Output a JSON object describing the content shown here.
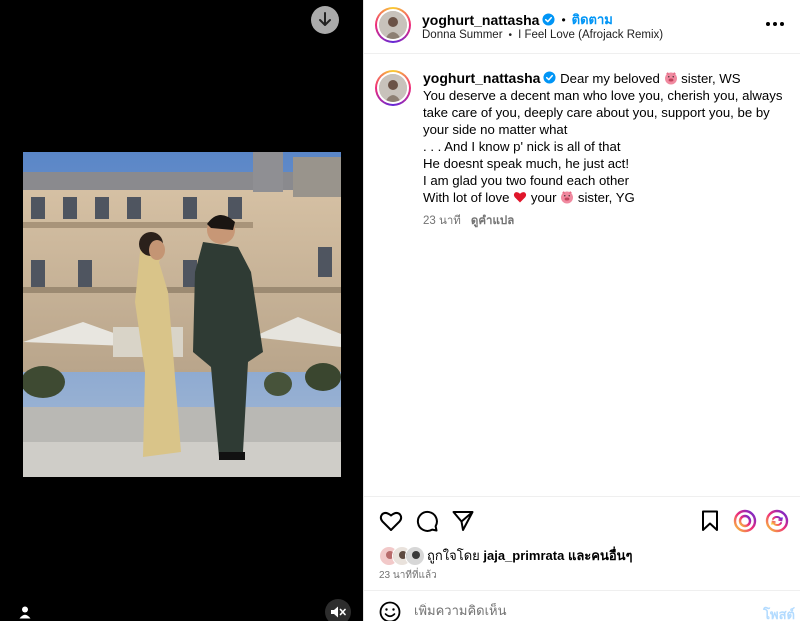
{
  "post": {
    "username": "yoghurt_nattasha",
    "follow_label": "ติดตาม",
    "dot": "•",
    "music": {
      "artist": "Donna Summer",
      "track": "I Feel Love (Afrojack Remix)"
    }
  },
  "caption": {
    "username": "yoghurt_nattasha",
    "line1_a": "Dear my beloved",
    "line1_b": "sister, WS",
    "line2": "You deserve a decent man who love you, cherish you, always take care of you, deeply care about you, support you, be by your side no matter what",
    "line3": ". . . And I know p' nick is all of that",
    "line4": "He doesnt speak much, he just act!",
    "line5": "I am glad you two found each other",
    "line6_a": "With lot of love",
    "line6_b": "your",
    "line6_c": "sister, YG",
    "time": "23 นาที",
    "translate": "ดูคำแปล"
  },
  "likes": {
    "prefix": "ถูกใจโดย",
    "user": "jaja_primrata",
    "suffix": "และคนอื่นๆ",
    "time": "23 นาทีที่แล้ว"
  },
  "comment": {
    "placeholder": "เพิ่มความคิดเห็น",
    "post_label": "โพสต์"
  },
  "icons": {
    "download": "download-icon",
    "more": "more-horizontal-icon",
    "verified": "verified-badge-icon",
    "pig": "pig-face-emoji",
    "heart_emoji": "red-heart-emoji",
    "like": "heart-icon",
    "comment": "comment-icon",
    "share": "send-icon",
    "save": "bookmark-icon",
    "user_tag": "user-tag-icon",
    "mute": "speaker-muted-icon",
    "emoji": "emoji-smile-icon"
  },
  "colors": {
    "accent": "#0095f6",
    "verified": "#0095f6",
    "post_disabled": "#b3dbff",
    "media_bg": "#000000"
  }
}
